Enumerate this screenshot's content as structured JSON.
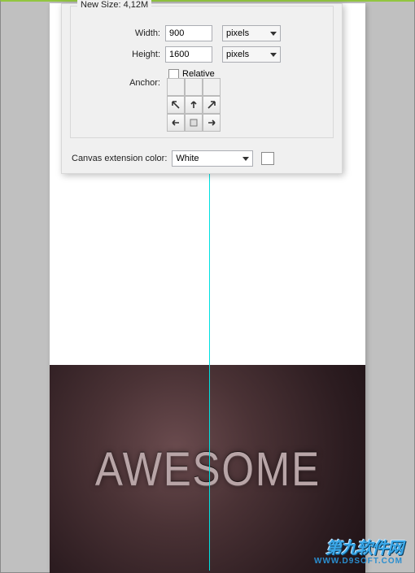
{
  "dialog": {
    "newSizeLabel": "New Size:",
    "newSizeValue": "4,12M",
    "widthLabel": "Width:",
    "widthValue": "900",
    "widthUnit": "pixels",
    "heightLabel": "Height:",
    "heightValue": "1600",
    "heightUnit": "pixels",
    "relativeLabel": "Relative",
    "anchorLabel": "Anchor:",
    "extLabel": "Canvas extension color:",
    "extValue": "White"
  },
  "artwork": {
    "text": "AWESOME"
  },
  "watermark": {
    "main": "第九软件网",
    "sub": "WWW.D9SOFT.COM"
  }
}
